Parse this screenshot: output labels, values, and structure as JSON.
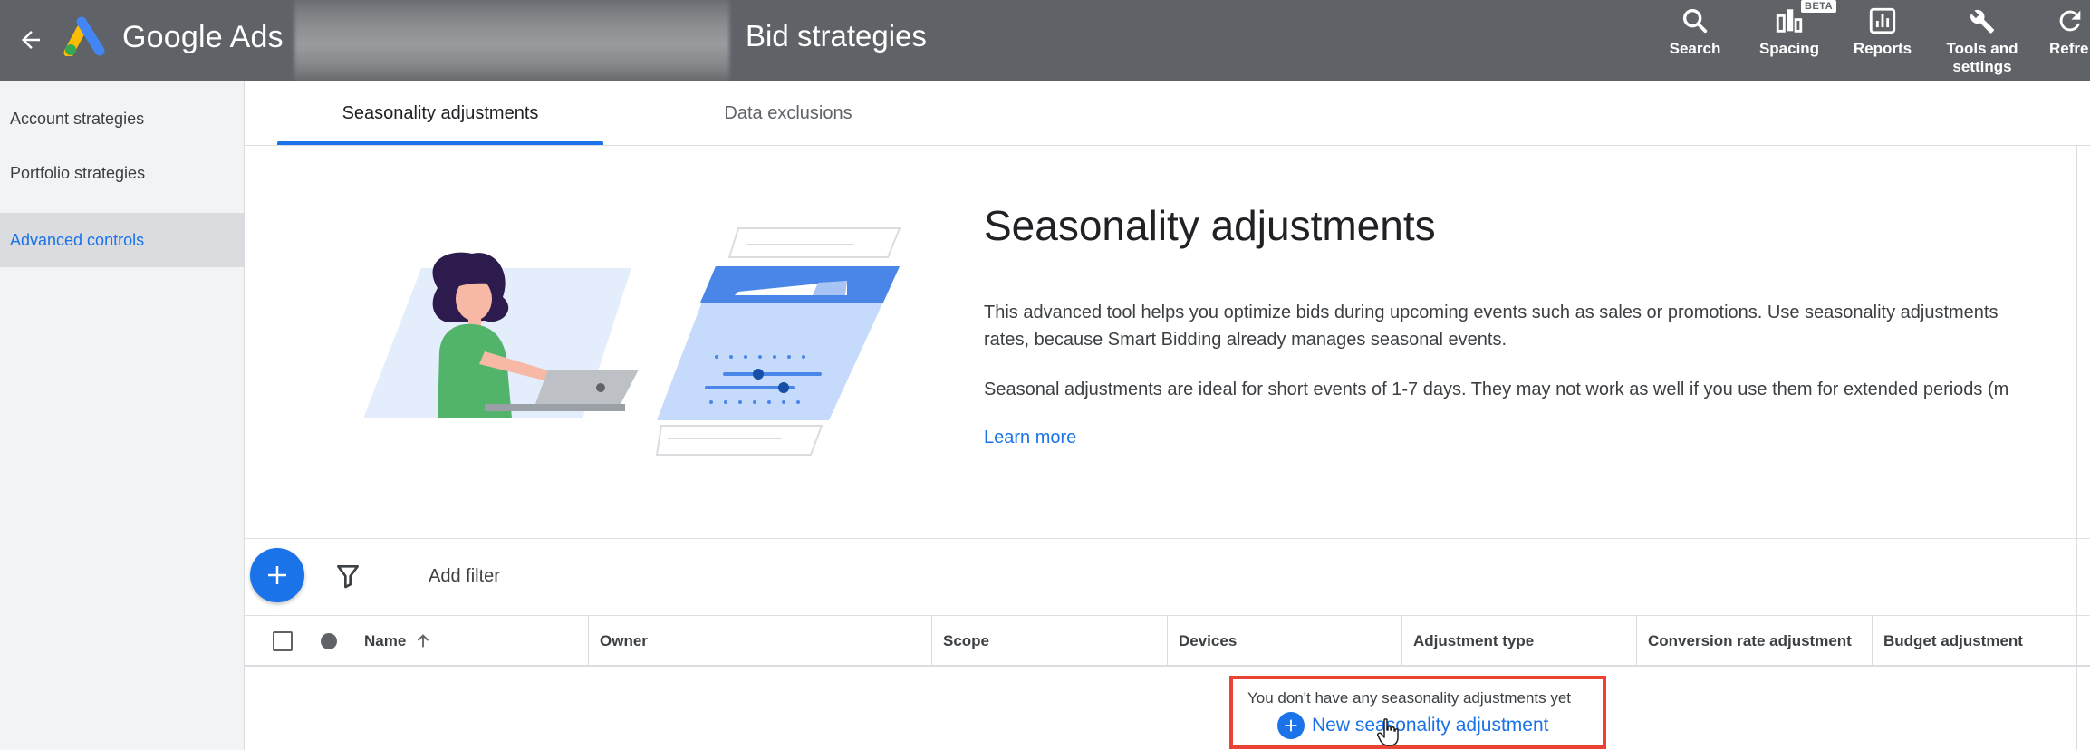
{
  "header": {
    "brand": "Google Ads",
    "page_title": "Bid strategies",
    "tools": [
      {
        "label": "Search",
        "icon": "search-icon"
      },
      {
        "label": "Spacing",
        "icon": "spacing-icon",
        "badge": "BETA"
      },
      {
        "label": "Reports",
        "icon": "reports-icon"
      },
      {
        "label": "Tools and settings",
        "icon": "wrench-icon"
      },
      {
        "label": "Refre",
        "icon": "refresh-icon"
      }
    ]
  },
  "sidebar": {
    "items": [
      {
        "label": "Account strategies"
      },
      {
        "label": "Portfolio strategies"
      },
      {
        "label": "Advanced controls",
        "active": true
      }
    ]
  },
  "tabs": [
    {
      "label": "Seasonality adjustments",
      "active": true
    },
    {
      "label": "Data exclusions"
    }
  ],
  "hero": {
    "title": "Seasonality adjustments",
    "paragraph_1_line_1": "This advanced tool helps you optimize bids during upcoming events such as sales or promotions. Use seasonality adjustments",
    "paragraph_1_line_2": "rates, because Smart Bidding already manages seasonal events.",
    "paragraph_2": "Seasonal adjustments are ideal for short events of 1-7 days. They may not work as well if you use them for extended periods (m",
    "learn_more": "Learn more"
  },
  "toolbar": {
    "add_filter": "Add filter"
  },
  "table": {
    "columns": [
      "Name",
      "Owner",
      "Scope",
      "Devices",
      "Adjustment type",
      "Conversion rate adjustment",
      "Budget adjustment"
    ],
    "empty_message": "You don't have any seasonality adjustments yet",
    "new_action": "New seasonality adjustment"
  },
  "colors": {
    "header_bg": "#5f6368",
    "accent": "#1a73e8",
    "highlight_border": "#ea4335",
    "sidebar_bg": "#f1f3f4"
  }
}
